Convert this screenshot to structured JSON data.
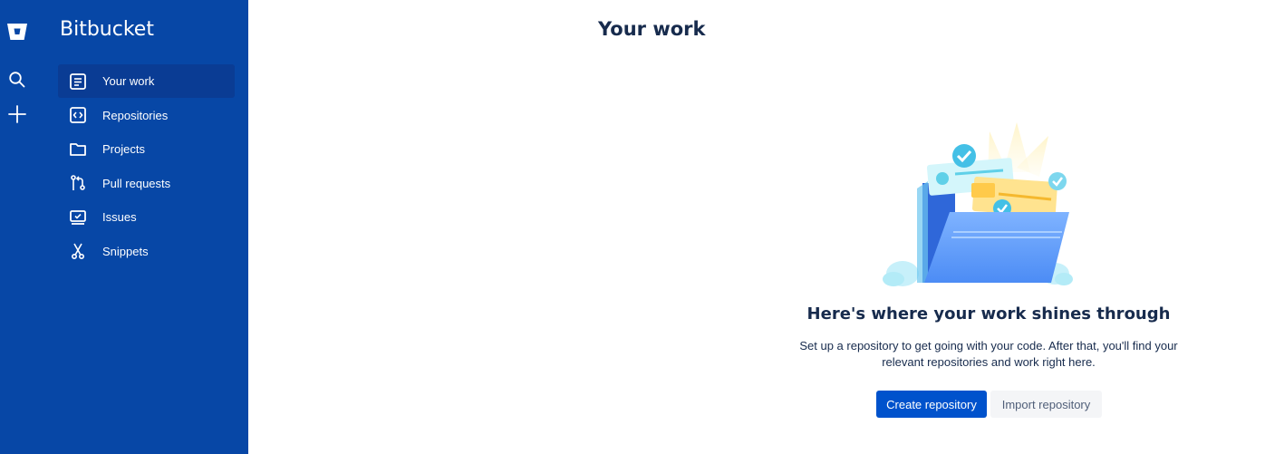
{
  "app": {
    "name": "Bitbucket",
    "brand_color": "#0747a6",
    "logo_icon": "bitbucket-logo"
  },
  "rail": {
    "search_icon": "search-icon",
    "create_icon": "plus-icon"
  },
  "nav": {
    "items": [
      {
        "label": "Your work",
        "icon": "your-work-icon",
        "active": true
      },
      {
        "label": "Repositories",
        "icon": "repository-icon",
        "active": false
      },
      {
        "label": "Projects",
        "icon": "folder-icon",
        "active": false
      },
      {
        "label": "Pull requests",
        "icon": "pull-request-icon",
        "active": false
      },
      {
        "label": "Issues",
        "icon": "issues-icon",
        "active": false
      },
      {
        "label": "Snippets",
        "icon": "snippets-icon",
        "active": false
      }
    ]
  },
  "main": {
    "title": "Your work",
    "empty_state": {
      "heading": "Here's where your work shines through",
      "description": "Set up a repository to get going with your code. After that, you'll find your relevant repositories and work right here.",
      "primary_button": "Create repository",
      "secondary_button": "Import repository"
    }
  },
  "colors": {
    "primary_button": "#0052cc",
    "secondary_button": "#f4f5f7",
    "text": "#172b4d"
  }
}
